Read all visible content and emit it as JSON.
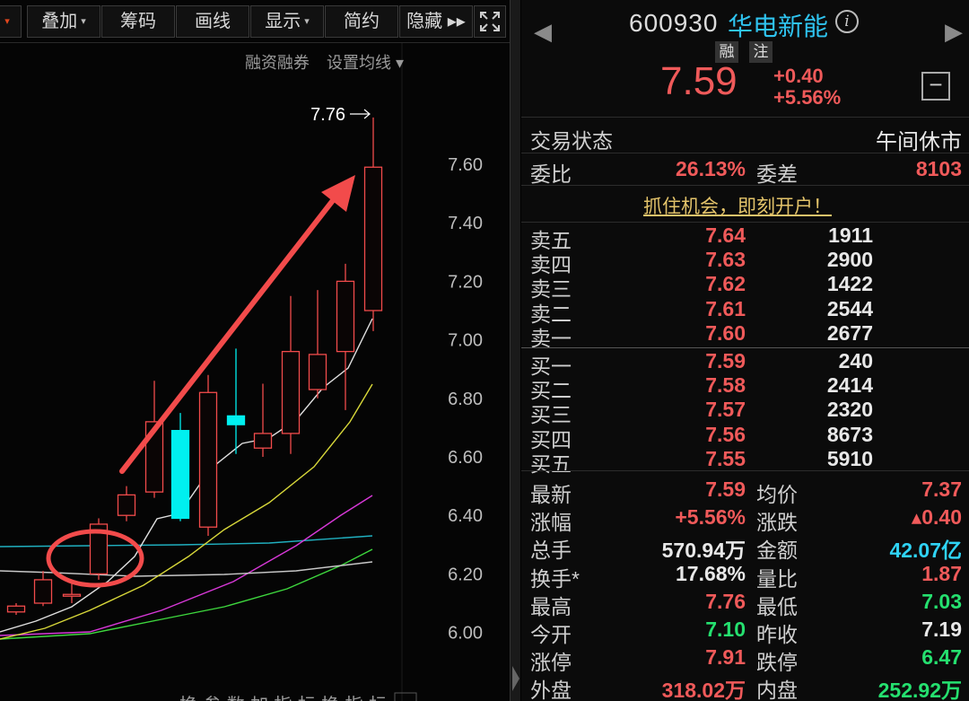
{
  "toolbar": {
    "first_caret": "▾",
    "buttons": [
      {
        "label": "叠加",
        "caret": "▾"
      },
      {
        "label": "筹码",
        "caret": ""
      },
      {
        "label": "画线",
        "caret": ""
      },
      {
        "label": "显示",
        "caret": "▾"
      },
      {
        "label": "简约",
        "caret": ""
      },
      {
        "label": "隐藏 ▸▸",
        "caret": ""
      }
    ],
    "fullscreen_icon": "expand-icon"
  },
  "subtools": {
    "margin": "融资融券",
    "ma": "设置均线 ▾"
  },
  "chart": {
    "high_label": "7.76",
    "y_ticks": [
      "7.60",
      "7.40",
      "7.20",
      "7.00",
      "6.80",
      "6.60",
      "6.40",
      "6.20",
      "6.00"
    ],
    "colors": {
      "up": "#f24b4b",
      "down": "#00f0f0",
      "ma5": "#e0e0e0",
      "ma10": "#d8d83a",
      "ma20": "#d838d8",
      "ma30": "#3ed83e",
      "ma60": "#20b0c0",
      "arrow": "#f24b4b"
    },
    "bottom_tabs": "换 参 数   加 指 标   换 指 标"
  },
  "stock": {
    "code": "600930",
    "name": "华电新能",
    "info_icon": "i",
    "tags": [
      "融",
      "注"
    ],
    "price": "7.59",
    "change": "+0.40",
    "change_pct": "+5.56%"
  },
  "status": {
    "label": "交易状态",
    "value": "午间休市"
  },
  "ratio": {
    "wb_label": "委比",
    "wb": "26.13%",
    "wc_label": "委差",
    "wc": "8103"
  },
  "promo": "抓住机会，即刻开户！",
  "asks": [
    {
      "name": "卖五",
      "price": "7.64",
      "vol": "1911"
    },
    {
      "name": "卖四",
      "price": "7.63",
      "vol": "2900"
    },
    {
      "name": "卖三",
      "price": "7.62",
      "vol": "1422"
    },
    {
      "name": "卖二",
      "price": "7.61",
      "vol": "2544"
    },
    {
      "name": "卖一",
      "price": "7.60",
      "vol": "2677"
    }
  ],
  "bids": [
    {
      "name": "买一",
      "price": "7.59",
      "vol": "240"
    },
    {
      "name": "买二",
      "price": "7.58",
      "vol": "2414"
    },
    {
      "name": "买三",
      "price": "7.57",
      "vol": "2320"
    },
    {
      "name": "买四",
      "price": "7.56",
      "vol": "8673"
    },
    {
      "name": "买五",
      "price": "7.55",
      "vol": "5910"
    }
  ],
  "stats": [
    {
      "l1": "最新",
      "v1": "7.59",
      "c1": "red",
      "l2": "均价",
      "v2": "7.37",
      "c2": "red"
    },
    {
      "l1": "涨幅",
      "v1": "+5.56%",
      "c1": "red",
      "l2": "涨跌",
      "v2": "▴0.40",
      "c2": "red"
    },
    {
      "l1": "总手",
      "v1": "570.94万",
      "c1": "white",
      "l2": "金额",
      "v2": "42.07亿",
      "c2": "cyan"
    },
    {
      "l1": "换手*",
      "v1": "17.68%",
      "c1": "white",
      "l2": "量比",
      "v2": "1.87",
      "c2": "red"
    },
    {
      "l1": "最高",
      "v1": "7.76",
      "c1": "red",
      "l2": "最低",
      "v2": "7.03",
      "c2": "green"
    },
    {
      "l1": "今开",
      "v1": "7.10",
      "c1": "green",
      "l2": "昨收",
      "v2": "7.19",
      "c2": "white"
    },
    {
      "l1": "涨停",
      "v1": "7.91",
      "c1": "red",
      "l2": "跌停",
      "v2": "6.47",
      "c2": "green"
    },
    {
      "l1": "外盘",
      "v1": "318.02万",
      "c1": "red",
      "l2": "内盘",
      "v2": "252.92万",
      "c2": "green"
    }
  ]
}
